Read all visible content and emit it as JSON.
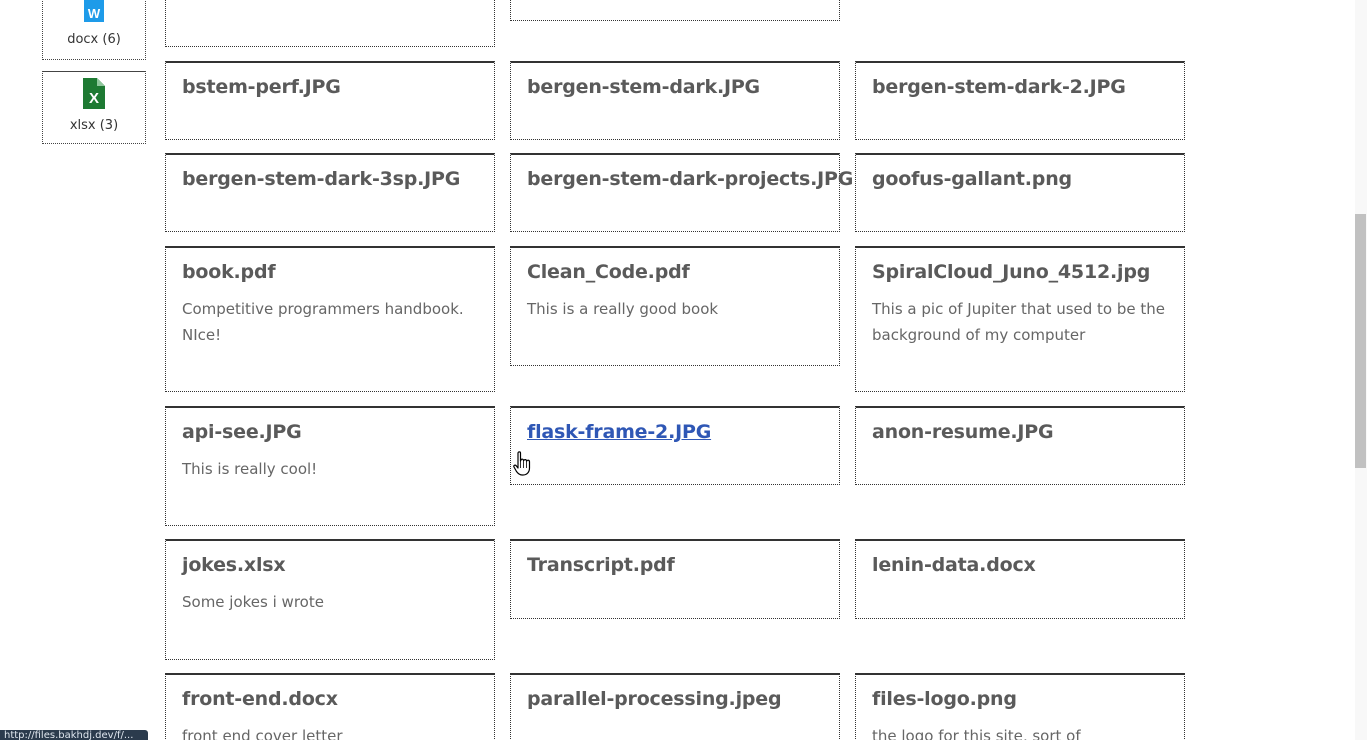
{
  "sidebar": {
    "types": [
      {
        "label": "docx (6)",
        "icon": "word-file-icon",
        "color": "#1e9be9",
        "letter": "W"
      },
      {
        "label": "xlsx (3)",
        "icon": "excel-file-icon",
        "color": "#1e7a33",
        "letter": "X"
      }
    ]
  },
  "files": [
    {
      "title": "bstem-perf.JPG",
      "desc": ""
    },
    {
      "title": "bergen-stem-dark.JPG",
      "desc": ""
    },
    {
      "title": "bergen-stem-dark-2.JPG",
      "desc": ""
    },
    {
      "title": "bergen-stem-dark-3sp.JPG",
      "desc": ""
    },
    {
      "title": "bergen-stem-dark-projects.JPG",
      "desc": ""
    },
    {
      "title": "goofus-gallant.png",
      "desc": ""
    },
    {
      "title": "book.pdf",
      "desc": "Competitive programmers handbook. NIce!"
    },
    {
      "title": "Clean_Code.pdf",
      "desc": "This is a really good book"
    },
    {
      "title": "SpiralCloud_Juno_4512.jpg",
      "desc": "This a pic of Jupiter that used to be the background of my computer"
    },
    {
      "title": "api-see.JPG",
      "desc": "This is really cool!"
    },
    {
      "title": "flask-frame-2.JPG",
      "desc": ""
    },
    {
      "title": "anon-resume.JPG",
      "desc": ""
    },
    {
      "title": "jokes.xlsx",
      "desc": "Some jokes i wrote"
    },
    {
      "title": "Transcript.pdf",
      "desc": ""
    },
    {
      "title": "lenin-data.docx",
      "desc": ""
    },
    {
      "title": "front-end.docx",
      "desc": "front end cover letter"
    },
    {
      "title": "parallel-processing.jpeg",
      "desc": ""
    },
    {
      "title": "files-logo.png",
      "desc": "the logo for this site, sort of"
    }
  ],
  "status_bar": {
    "url": "http://files.bakhdj.dev/f/..."
  }
}
